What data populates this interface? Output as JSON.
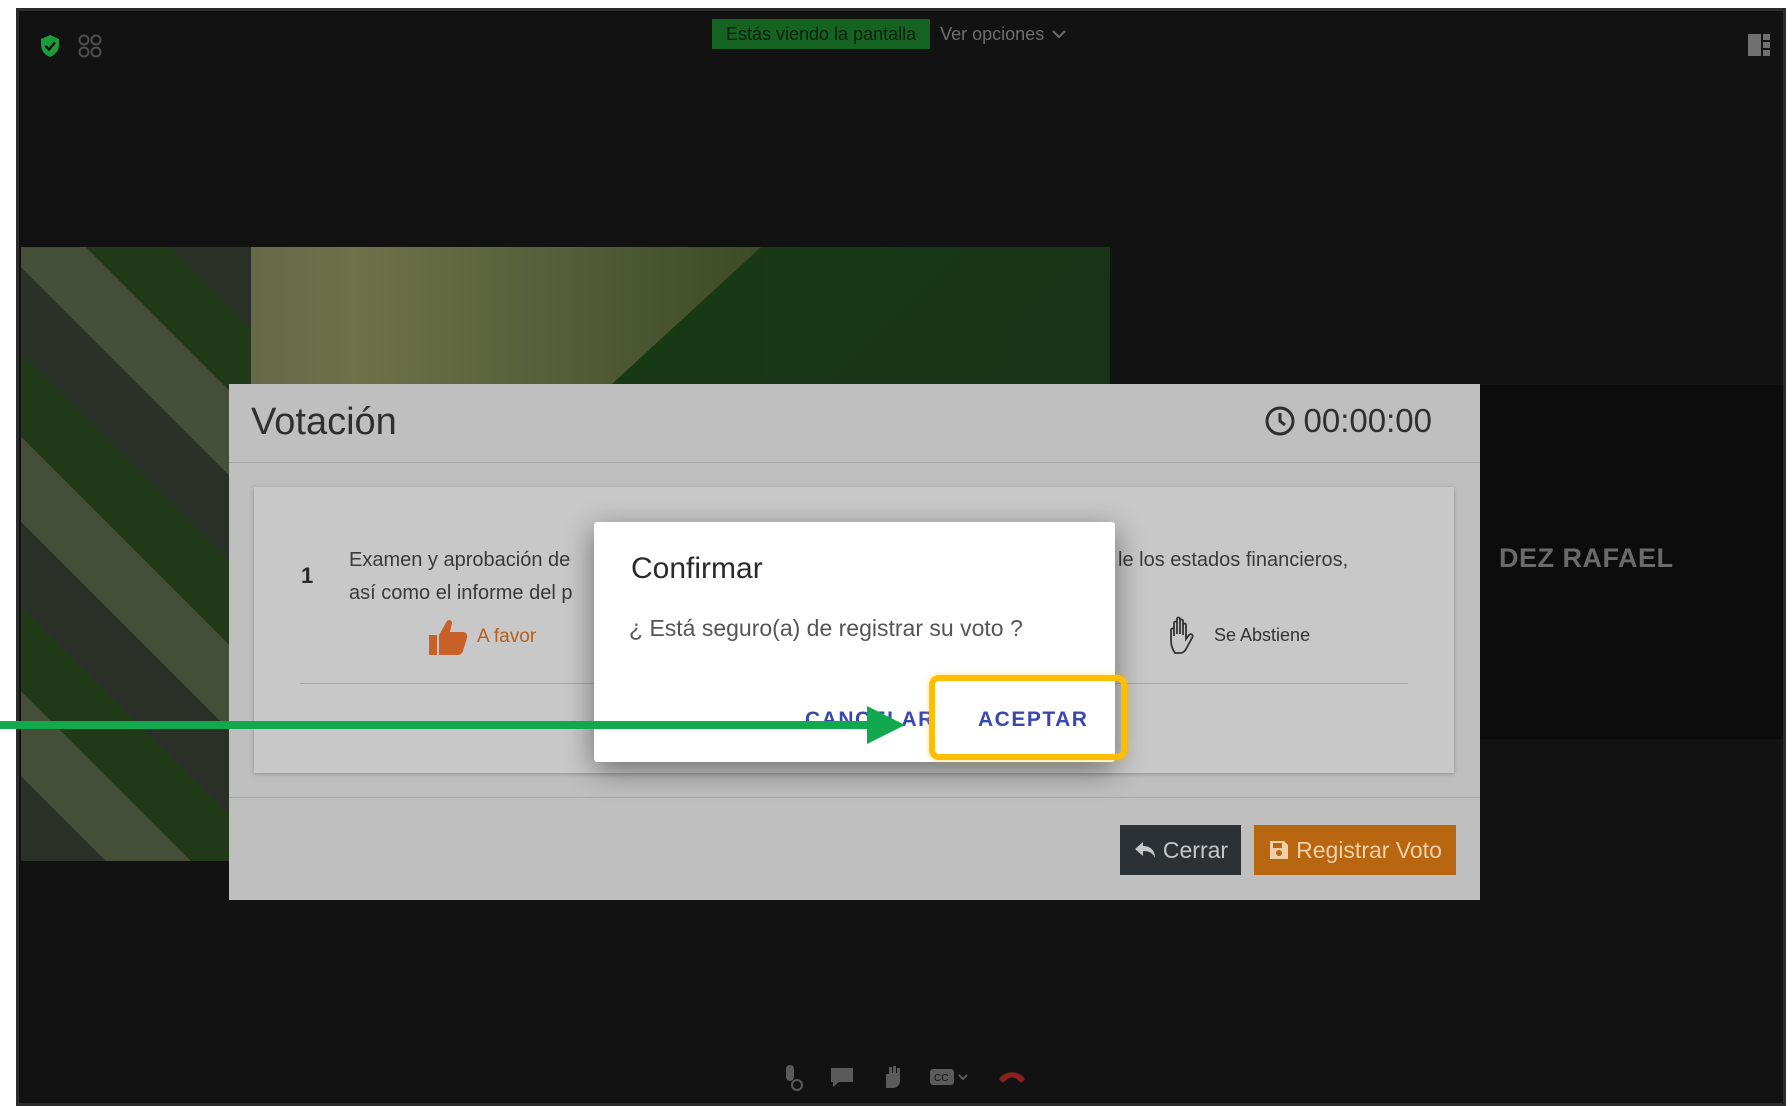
{
  "meeting": {
    "share_banner": "Estás viendo la pantalla",
    "options_label": "Ver opciones",
    "participant_name": "DEZ RAFAEL"
  },
  "vote_dialog": {
    "title": "Votación",
    "timer": "00:00:00",
    "question": {
      "number": "1",
      "text_line1": "Examen y aprobación de",
      "text_line2": "así como el informe del p",
      "text_right": "le los estados financieros,",
      "option_favor": "A favor",
      "option_abstain": "Se Abstiene"
    },
    "close_label": "Cerrar",
    "register_label": "Registrar Voto"
  },
  "confirm_dialog": {
    "title": "Confirmar",
    "message": "¿ Está seguro(a) de registrar su voto ?",
    "cancel_label": "CANCELAR",
    "accept_label": "ACEPTAR"
  },
  "colors": {
    "highlight": "#ffbf00",
    "arrow": "#11a84e",
    "register_button": "#b8660f",
    "accent_blue": "#3848b0"
  },
  "icons": [
    "shield-check-icon",
    "grid-icon",
    "chevron-down-icon",
    "layout-icon",
    "clock-icon",
    "thumbs-up-icon",
    "hand-icon",
    "reply-icon",
    "save-icon",
    "mic-icon",
    "chat-icon",
    "raise-hand-icon",
    "cc-icon",
    "hangup-icon"
  ]
}
